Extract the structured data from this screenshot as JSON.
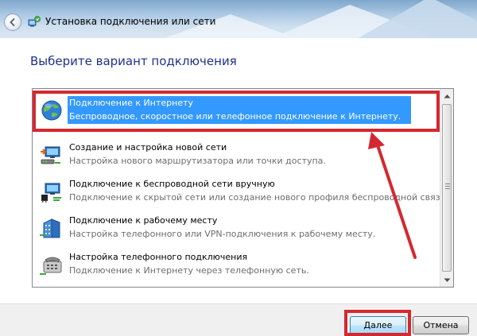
{
  "window": {
    "title": "Установка подключения или сети"
  },
  "page": {
    "heading": "Выберите вариант подключения"
  },
  "options": [
    {
      "title": "Подключение к Интернету",
      "description": "Беспроводное, скоростное или телефонное подключение к Интернету.",
      "icon": "globe-icon",
      "selected": true
    },
    {
      "title": "Создание и настройка новой сети",
      "description": "Настройка нового маршрутизатора или точки доступа.",
      "icon": "network-setup-icon",
      "selected": false
    },
    {
      "title": "Подключение к беспроводной сети вручную",
      "description": "Подключение к скрытой сети или создание нового профиля беспроводной связи.",
      "icon": "wireless-network-icon",
      "selected": false
    },
    {
      "title": "Подключение к рабочему месту",
      "description": "Настройка телефонного или VPN-подключения к рабочему месту.",
      "icon": "workplace-icon",
      "selected": false
    },
    {
      "title": "Настройка телефонного подключения",
      "description": "Подключение к Интернету через телефонную сеть.",
      "icon": "phone-modem-icon",
      "selected": false
    }
  ],
  "buttons": {
    "next": "Далее",
    "cancel": "Отмена"
  },
  "annotation": {
    "color": "#d42830"
  },
  "colors": {
    "selection": "#3399ff",
    "heading": "#1e3287"
  }
}
